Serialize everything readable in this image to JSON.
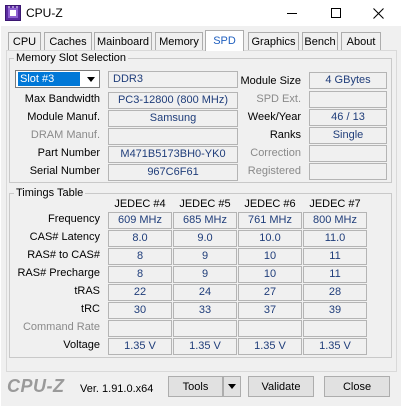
{
  "window": {
    "title": "CPU-Z"
  },
  "tabs": [
    "CPU",
    "Caches",
    "Mainboard",
    "Memory",
    "SPD",
    "Graphics",
    "Bench",
    "About"
  ],
  "active_tab": "SPD",
  "slot": {
    "group_title": "Memory Slot Selection",
    "selected": "Slot #3",
    "type": "DDR3",
    "labels": {
      "max_bandwidth": "Max Bandwidth",
      "module_manuf": "Module Manuf.",
      "dram_manuf": "DRAM Manuf.",
      "part_number": "Part Number",
      "serial_number": "Serial Number",
      "module_size": "Module Size",
      "spd_ext": "SPD Ext.",
      "week_year": "Week/Year",
      "ranks": "Ranks",
      "correction": "Correction",
      "registered": "Registered"
    },
    "values": {
      "max_bandwidth": "PC3-12800 (800 MHz)",
      "module_manuf": "Samsung",
      "dram_manuf": "",
      "part_number": "M471B5173BH0-YK0",
      "serial_number": "967C6F61",
      "module_size": "4 GBytes",
      "spd_ext": "",
      "week_year": "46 / 13",
      "ranks": "Single",
      "correction": "",
      "registered": ""
    }
  },
  "timings": {
    "group_title": "Timings Table",
    "columns": [
      "JEDEC #4",
      "JEDEC #5",
      "JEDEC #6",
      "JEDEC #7"
    ],
    "rows": [
      {
        "label": "Frequency",
        "values": [
          "609 MHz",
          "685 MHz",
          "761 MHz",
          "800 MHz"
        ]
      },
      {
        "label": "CAS# Latency",
        "values": [
          "8.0",
          "9.0",
          "10.0",
          "11.0"
        ]
      },
      {
        "label": "RAS# to CAS#",
        "values": [
          "8",
          "9",
          "10",
          "11"
        ]
      },
      {
        "label": "RAS# Precharge",
        "values": [
          "8",
          "9",
          "10",
          "11"
        ]
      },
      {
        "label": "tRAS",
        "values": [
          "22",
          "24",
          "27",
          "28"
        ]
      },
      {
        "label": "tRC",
        "values": [
          "30",
          "33",
          "37",
          "39"
        ]
      },
      {
        "label": "Command Rate",
        "values": [
          "",
          "",
          "",
          ""
        ]
      },
      {
        "label": "Voltage",
        "values": [
          "1.35 V",
          "1.35 V",
          "1.35 V",
          "1.35 V"
        ]
      }
    ]
  },
  "footer": {
    "brand": "CPU-Z",
    "version": "Ver. 1.91.0.x64",
    "tools_label": "Tools",
    "validate_label": "Validate",
    "close_label": "Close"
  },
  "colors": {
    "value_text": "#1f3d7a",
    "active_tab": "#1f5fbf",
    "selection": "#0078d7"
  },
  "icons": [
    "app-icon",
    "minimize-icon",
    "maximize-icon",
    "close-icon",
    "dropdown-arrow-icon"
  ]
}
